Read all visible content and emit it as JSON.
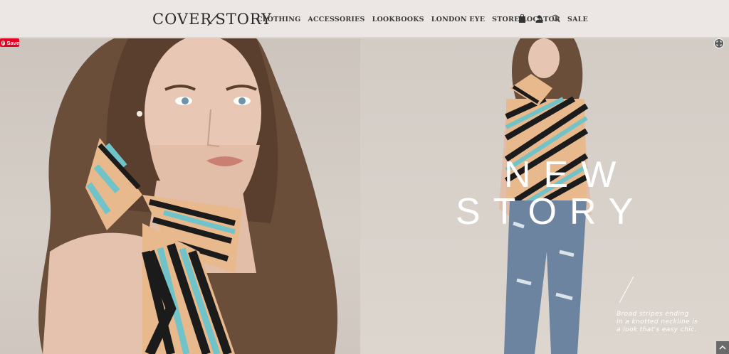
{
  "header": {
    "logo_part1": "COVER",
    "logo_slash": "/",
    "logo_part2": "STORY",
    "nav": [
      "CLOTHING",
      "ACCESSORIES",
      "LOOKBOOKS",
      "LONDON EYE",
      "STORE LOCATOR",
      "SALE"
    ],
    "icons": [
      "bag-icon",
      "user-icon",
      "search-icon"
    ]
  },
  "pin_save": {
    "label": "Save",
    "color": "#e60023"
  },
  "hero": {
    "headline_line1": "NEW",
    "headline_line2": "STORY",
    "caption_line1": "Broad stripes ending",
    "caption_line2": "in a knotted neckline is",
    "caption_line3": "a look that's easy chic."
  },
  "colors": {
    "topbar_bg": "#ece7e4",
    "stripe_tan": "#e8b98c",
    "stripe_teal": "#6fc3c9",
    "stripe_black": "#1b1b1b"
  }
}
